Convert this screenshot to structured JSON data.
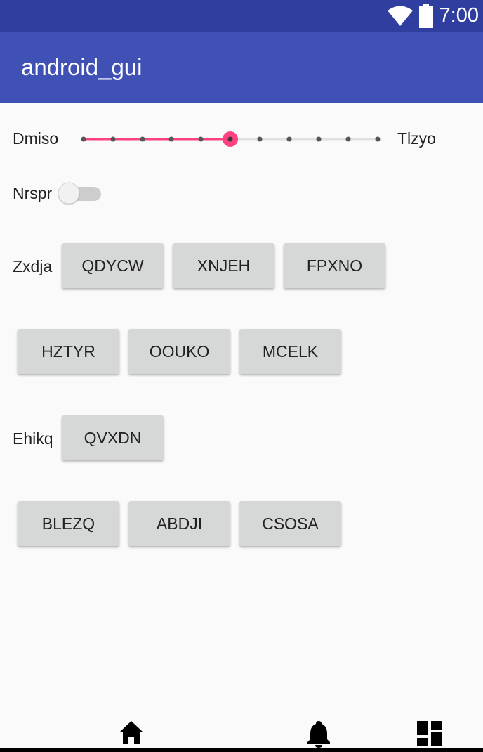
{
  "status_bar": {
    "time": "7:00",
    "icons": [
      "wifi-icon",
      "battery-icon"
    ]
  },
  "app_bar": {
    "title": "android_gui"
  },
  "slider": {
    "left_label": "Dmiso",
    "right_label": "Tlzyo",
    "steps": 11,
    "value_index": 5,
    "accent": "#ff4081"
  },
  "switch": {
    "label": "Nrspr",
    "checked": false
  },
  "group1": {
    "label": "Zxdja",
    "buttons": [
      "QDYCW",
      "XNJEH",
      "FPXNO",
      "HZTYR",
      "OOUKO",
      "MCELK"
    ]
  },
  "group2": {
    "label": "Ehikq",
    "buttons": [
      "QVXDN",
      "BLEZQ",
      "ABDJI",
      "CSOSA"
    ]
  },
  "bottom_nav": {
    "items": [
      "home-icon",
      "bell-icon",
      "dashboard-icon"
    ]
  },
  "colors": {
    "primary": "#3f51b5",
    "primary_dark": "#303f9f",
    "accent": "#ff4081",
    "button_bg": "#d6d7d7"
  }
}
